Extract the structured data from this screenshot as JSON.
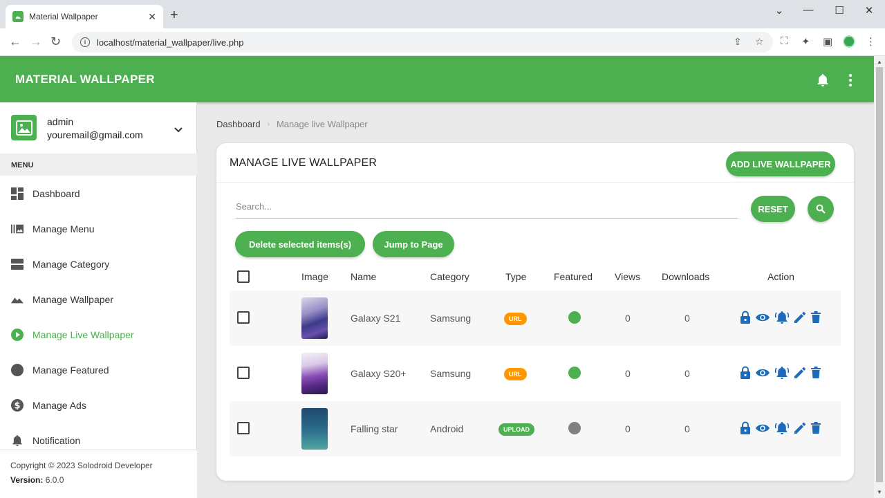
{
  "browser": {
    "tab_title": "Material Wallpaper",
    "url": "localhost/material_wallpaper/live.php"
  },
  "app": {
    "title": "MATERIAL WALLPAPER"
  },
  "user": {
    "name": "admin",
    "email": "youremail@gmail.com"
  },
  "sidebar": {
    "menu_label": "MENU",
    "items": [
      {
        "label": "Dashboard",
        "icon": "dashboard-icon"
      },
      {
        "label": "Manage Menu",
        "icon": "menu-grid-icon"
      },
      {
        "label": "Manage Category",
        "icon": "category-icon"
      },
      {
        "label": "Manage Wallpaper",
        "icon": "landscape-icon"
      },
      {
        "label": "Manage Live Wallpaper",
        "icon": "play-circle-icon",
        "active": true
      },
      {
        "label": "Manage Featured",
        "icon": "circle-icon"
      },
      {
        "label": "Manage Ads",
        "icon": "dollar-icon"
      },
      {
        "label": "Notification",
        "icon": "bell-icon"
      }
    ],
    "footer": {
      "copyright": "Copyright © 2023 Solodroid Developer",
      "version_label": "Version:",
      "version": "6.0.0"
    }
  },
  "breadcrumb": {
    "home": "Dashboard",
    "current": "Manage live Wallpaper"
  },
  "card": {
    "title": "MANAGE LIVE WALLPAPER",
    "add_button": "ADD LIVE WALLPAPER",
    "search_placeholder": "Search...",
    "reset_button": "RESET",
    "delete_button": "Delete selected items(s)",
    "jump_button": "Jump to Page"
  },
  "table": {
    "headers": [
      "Image",
      "Name",
      "Category",
      "Type",
      "Featured",
      "Views",
      "Downloads",
      "Action"
    ],
    "rows": [
      {
        "name": "Galaxy S21",
        "category": "Samsung",
        "type": "URL",
        "featured": true,
        "views": "0",
        "downloads": "0"
      },
      {
        "name": "Galaxy S20+",
        "category": "Samsung",
        "type": "URL",
        "featured": true,
        "views": "0",
        "downloads": "0"
      },
      {
        "name": "Falling star",
        "category": "Android",
        "type": "UPLOAD",
        "featured": false,
        "views": "0",
        "downloads": "0"
      }
    ]
  },
  "colors": {
    "primary": "#4caf50",
    "badge_url": "#ff9800",
    "badge_upload": "#4caf50",
    "action_blue": "#1e6bb8",
    "featured_off": "#808080"
  }
}
